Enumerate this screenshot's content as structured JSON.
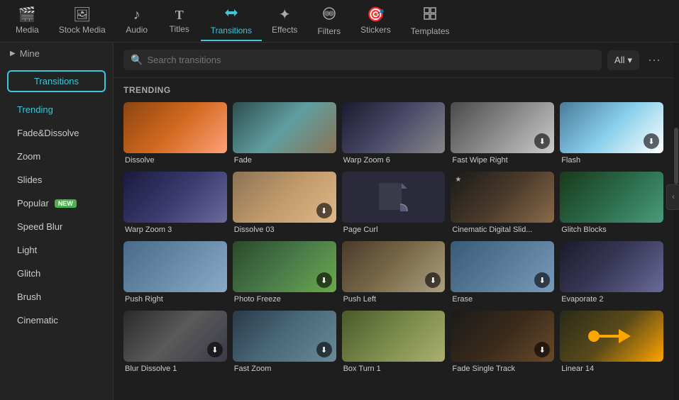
{
  "nav": {
    "items": [
      {
        "id": "media",
        "label": "Media",
        "icon": "🎬"
      },
      {
        "id": "stock-media",
        "label": "Stock Media",
        "icon": "📷"
      },
      {
        "id": "audio",
        "label": "Audio",
        "icon": "🎵"
      },
      {
        "id": "titles",
        "label": "Titles",
        "icon": "T"
      },
      {
        "id": "transitions",
        "label": "Transitions",
        "icon": "⇄",
        "active": true
      },
      {
        "id": "effects",
        "label": "Effects",
        "icon": "✦"
      },
      {
        "id": "filters",
        "label": "Filters",
        "icon": "◈"
      },
      {
        "id": "stickers",
        "label": "Stickers",
        "icon": "🎯"
      },
      {
        "id": "templates",
        "label": "Templates",
        "icon": "⊞"
      }
    ]
  },
  "sidebar": {
    "mine_label": "Mine",
    "active_tab_label": "Transitions",
    "items": [
      {
        "id": "trending",
        "label": "Trending",
        "active": true
      },
      {
        "id": "fadedissolve",
        "label": "Fade&Dissolve"
      },
      {
        "id": "zoom",
        "label": "Zoom"
      },
      {
        "id": "slides",
        "label": "Slides"
      },
      {
        "id": "popular",
        "label": "Popular",
        "badge": "NEW"
      },
      {
        "id": "speedblur",
        "label": "Speed Blur"
      },
      {
        "id": "light",
        "label": "Light"
      },
      {
        "id": "glitch",
        "label": "Glitch"
      },
      {
        "id": "brush",
        "label": "Brush"
      },
      {
        "id": "cinematic",
        "label": "Cinematic"
      }
    ]
  },
  "search": {
    "placeholder": "Search transitions",
    "filter_label": "All"
  },
  "trending_label": "TRENDING",
  "transitions": [
    {
      "id": "dissolve",
      "label": "Dissolve",
      "thumb_class": "thumb-dissolve",
      "has_download": false
    },
    {
      "id": "fade",
      "label": "Fade",
      "thumb_class": "thumb-fade",
      "has_download": false
    },
    {
      "id": "warp-zoom-6",
      "label": "Warp Zoom 6",
      "thumb_class": "thumb-warpzoom6",
      "has_download": false
    },
    {
      "id": "fast-wipe-right",
      "label": "Fast Wipe Right",
      "thumb_class": "thumb-fastwipe",
      "has_download": true
    },
    {
      "id": "flash",
      "label": "Flash",
      "thumb_class": "thumb-flash",
      "has_download": true
    },
    {
      "id": "warp-zoom-3",
      "label": "Warp Zoom 3",
      "thumb_class": "thumb-warpzoom3",
      "has_download": false
    },
    {
      "id": "dissolve-03",
      "label": "Dissolve 03",
      "thumb_class": "thumb-dissolve03",
      "has_download": true
    },
    {
      "id": "page-curl",
      "label": "Page Curl",
      "thumb_class": "thumb-pagecurl",
      "has_download": false,
      "special": "pagecurl"
    },
    {
      "id": "cinematic-digital-slid",
      "label": "Cinematic Digital Slid...",
      "thumb_class": "thumb-cinematic",
      "has_download": false
    },
    {
      "id": "glitch-blocks",
      "label": "Glitch Blocks",
      "thumb_class": "thumb-glitchblocks",
      "has_download": false
    },
    {
      "id": "push-right",
      "label": "Push Right",
      "thumb_class": "thumb-pushright",
      "has_download": false
    },
    {
      "id": "photo-freeze",
      "label": "Photo Freeze",
      "thumb_class": "thumb-photofreeze",
      "has_download": true
    },
    {
      "id": "push-left",
      "label": "Push Left",
      "thumb_class": "thumb-pushleft",
      "has_download": true
    },
    {
      "id": "erase",
      "label": "Erase",
      "thumb_class": "thumb-erase",
      "has_download": true
    },
    {
      "id": "evaporate-2",
      "label": "Evaporate 2",
      "thumb_class": "thumb-evaporate",
      "has_download": false
    },
    {
      "id": "blur-dissolve-1",
      "label": "Blur Dissolve 1",
      "thumb_class": "thumb-blurdissolve",
      "has_download": true
    },
    {
      "id": "fast-zoom",
      "label": "Fast Zoom",
      "thumb_class": "thumb-fastzoom",
      "has_download": true
    },
    {
      "id": "box-turn-1",
      "label": "Box Turn 1",
      "thumb_class": "thumb-boxturn",
      "has_download": false
    },
    {
      "id": "fade-single-track",
      "label": "Fade Single Track",
      "thumb_class": "thumb-fadesingletrack",
      "has_download": true
    },
    {
      "id": "linear-14",
      "label": "Linear 14",
      "thumb_class": "thumb-linear14",
      "has_download": false
    }
  ],
  "cursor_on": "fast-wipe-right"
}
